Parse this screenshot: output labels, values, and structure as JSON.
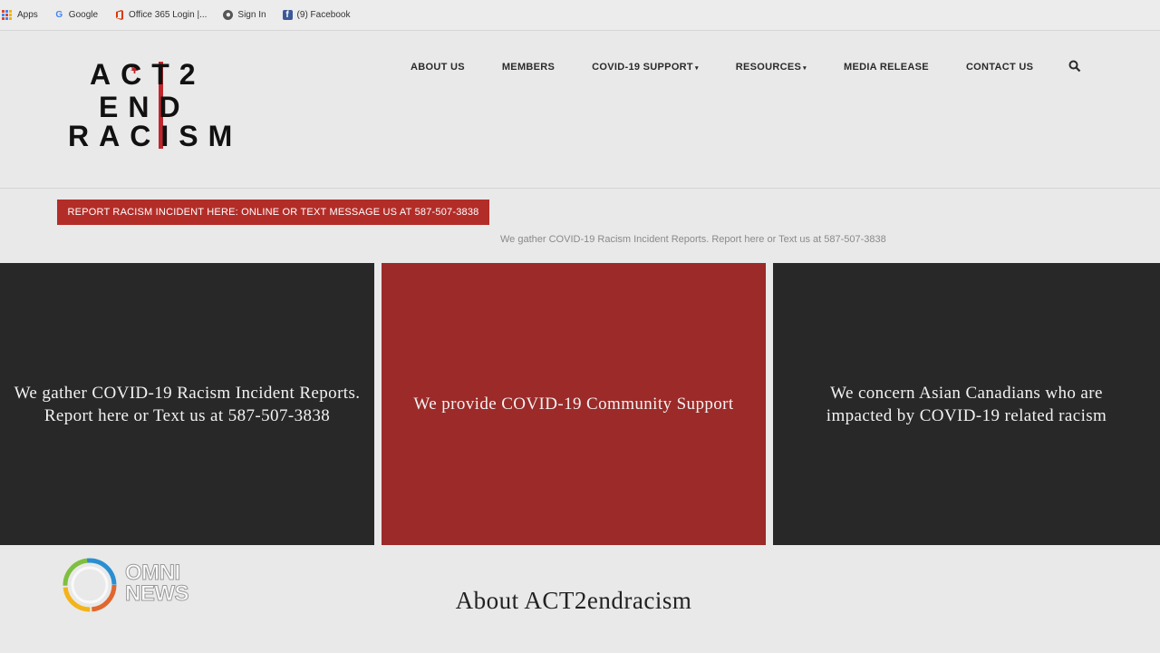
{
  "bookmarks": [
    {
      "label": "Apps",
      "icon": "apps-grid-icon"
    },
    {
      "label": "Google",
      "icon": "google-icon"
    },
    {
      "label": "Office 365 Login |...",
      "icon": "office-365-icon"
    },
    {
      "label": "Sign In",
      "icon": "sign-in-icon"
    },
    {
      "label": "(9) Facebook",
      "icon": "facebook-icon"
    }
  ],
  "logo": {
    "line1": "ACT2",
    "line2": "END",
    "line3": "RACISM"
  },
  "nav": {
    "items": [
      {
        "label": "ABOUT US"
      },
      {
        "label": "MEMBERS"
      },
      {
        "label": "COVID-19 SUPPORT",
        "caret": "▾"
      },
      {
        "label": "RESOURCES",
        "caret": "▾"
      },
      {
        "label": "MEDIA RELEASE"
      },
      {
        "label": "CONTACT US"
      }
    ],
    "search_icon": "search-icon"
  },
  "report_button": "REPORT RACISM INCIDENT HERE: ONLINE OR TEXT MESSAGE US AT 587-507-3838",
  "ticker": "We gather COVID-19 Racism Incident Reports. Report here or Text us at 587-507-3838",
  "panels": [
    {
      "text": "We gather COVID-19 Racism Incident Reports. Report here or Text us at 587-507-3838",
      "color": "#282828"
    },
    {
      "text": "We provide COVID-19 Community Support",
      "color": "#9b2a28"
    },
    {
      "text": "We concern Asian Canadians who are impacted by COVID-19 related racism",
      "color": "#282828"
    }
  ],
  "about_heading": "About ACT2endracism",
  "watermark": {
    "line1": "OMNI",
    "line2": "NEWS"
  },
  "colors": {
    "accent_red": "#b32d28",
    "panel_dark": "#282828",
    "panel_red": "#9b2a28"
  }
}
